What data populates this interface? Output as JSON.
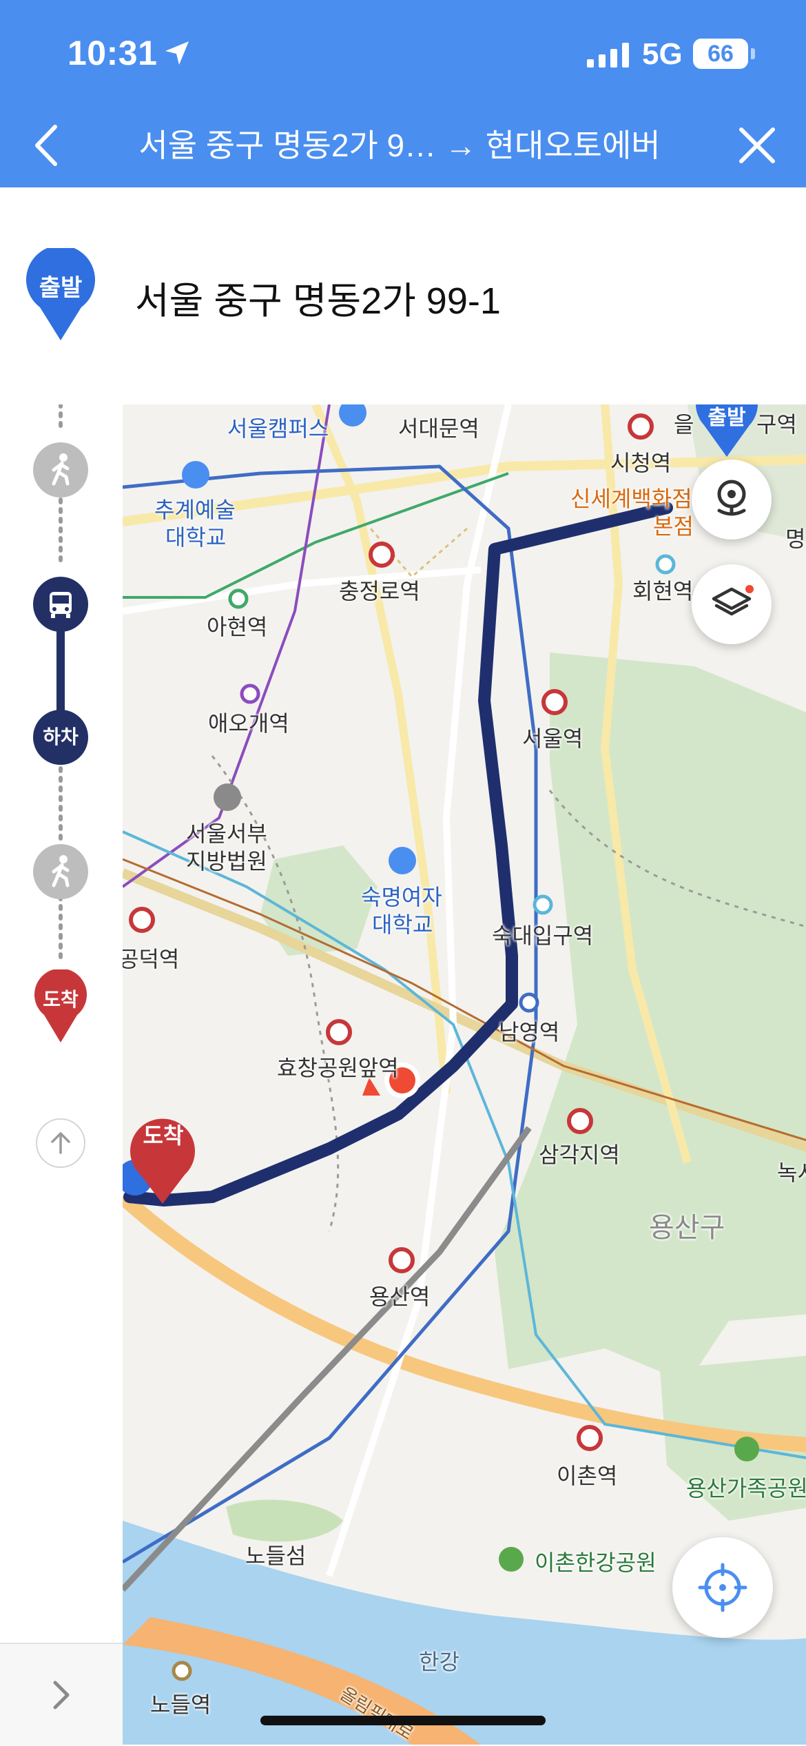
{
  "status_bar": {
    "time": "10:31",
    "network": "5G",
    "battery": "66"
  },
  "nav": {
    "title": "서울 중구 명동2가 9… → 현대오토에버"
  },
  "origin": {
    "badge": "출발",
    "address": "서울 중구 명동2가 99-1"
  },
  "timeline": {
    "start_badge": "출발",
    "alight_badge": "하차",
    "end_badge": "도착",
    "steps": [
      "walk-icon",
      "bus-icon",
      "walk-icon"
    ]
  },
  "map": {
    "labels": {
      "seoul_campus": "서울캠퍼스",
      "seodaemun": "서대문역",
      "cityhall": "시청역",
      "origin_label": "을",
      "guyeok": "구역",
      "shinsegae1": "신세계백화점",
      "shinsegae2": "본점",
      "myeong": "명",
      "chugye1": "추계예술",
      "chugye2": "대학교",
      "chungjeongno": "충정로역",
      "hoehyeon": "회현역",
      "ahyeon": "아현역",
      "aeogae": "애오개역",
      "seoul_station": "서울역",
      "court1": "서울서부",
      "court2": "지방법원",
      "sookmyung1": "숙명여자",
      "sookmyung2": "대학교",
      "sookdae": "숙대입구역",
      "gongdeok": "공덕역",
      "namyeong": "남영역",
      "hyochang": "효창공원앞역",
      "samgakji": "삼각지역",
      "nok": "녹시",
      "yongsan_gu": "용산구",
      "yongsan_station": "용산역",
      "ichon": "이촌역",
      "family_park": "용산가족공원",
      "nodeulseom": "노들섬",
      "ichon_park": "이촌한강공원",
      "hangang": "한강",
      "nodeul": "노들역",
      "olympic": "올림픽대로",
      "start_pin": "출발",
      "end_pin": "도착"
    },
    "colors": {
      "route": "#1f2f6e",
      "accent": "#4a8ef0",
      "start_pin": "#2f6fe0",
      "end_pin": "#c7373a",
      "current_location": "#ef4a33",
      "water": "#a9d3ef",
      "park": "#d3e6c9"
    }
  },
  "controls": {
    "street_view": "street-view-icon",
    "layers": "layers-icon",
    "my_location": "crosshair-icon",
    "expand": "chevron-right-icon",
    "scroll_top": "arrow-up-icon"
  }
}
